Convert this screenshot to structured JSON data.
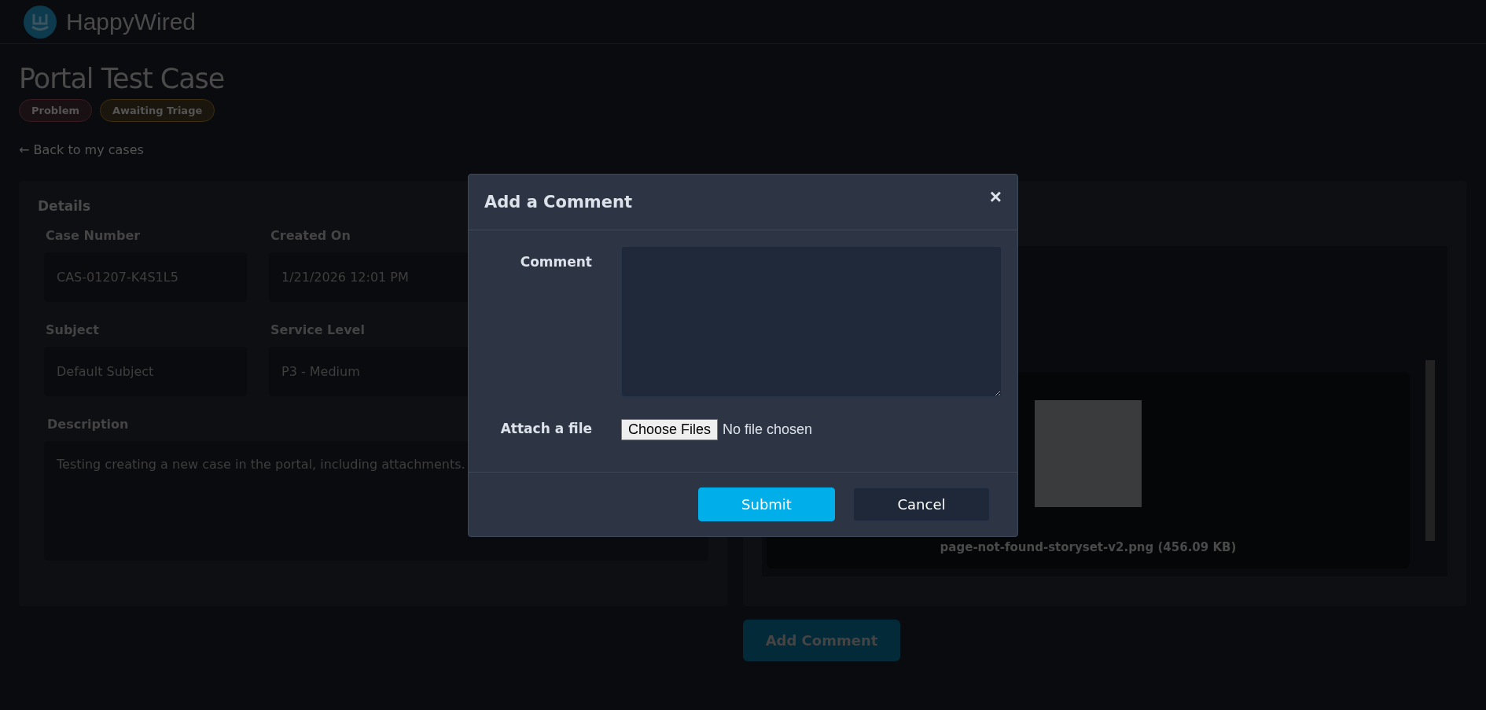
{
  "header": {
    "brand": "HappyWired"
  },
  "case": {
    "title": "Portal Test Case",
    "badges": [
      {
        "label": "Problem",
        "color": "#3a1a20"
      },
      {
        "label": "Awaiting Triage",
        "color": "#3d2e0c"
      }
    ],
    "back_link": "← Back to my cases"
  },
  "details": {
    "title": "Details",
    "fields": [
      {
        "label": "Case Number",
        "value": "CAS-01207-K4S1L5"
      },
      {
        "label": "Created On",
        "value": "1/21/2026 12:01 PM"
      },
      {
        "label": "Subject",
        "value": "Default Subject"
      },
      {
        "label": "Service Level",
        "value": "P3 - Medium"
      }
    ],
    "description": {
      "label": "Description",
      "value": "Testing creating a new case in the portal, including attachments."
    }
  },
  "attachments": [
    {
      "name": "page-not-found-storyset-v2.png (456.09 KB)"
    }
  ],
  "add_comment_button": "Add Comment",
  "modal": {
    "title": "Add a Comment",
    "close": "×",
    "comment_label": "Comment",
    "attach_label": "Attach a file",
    "file_button": "Choose Files",
    "file_status": "No file chosen",
    "buttons": [
      {
        "label": "Submit",
        "kind": "primary"
      },
      {
        "label": "Cancel",
        "kind": "secondary"
      }
    ]
  }
}
